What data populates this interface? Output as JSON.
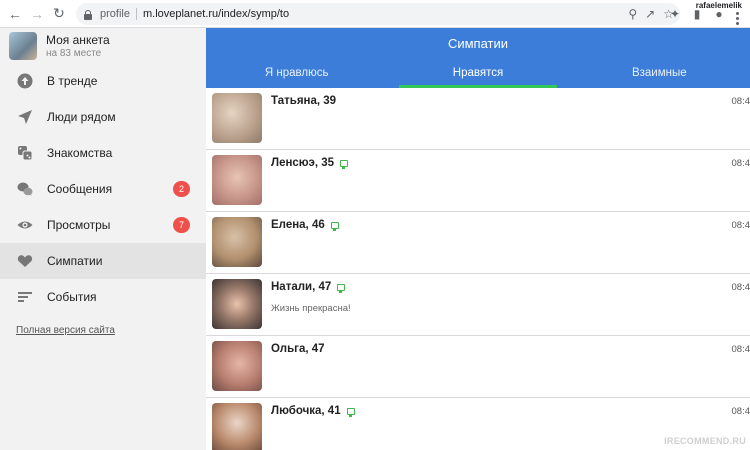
{
  "browser": {
    "address_label": "profile",
    "url": "m.loveplanet.ru/index/symp/to",
    "profile_name": "rafaelemelik"
  },
  "sidebar": {
    "me": {
      "title": "Моя анкета",
      "subtitle": "на 83 месте"
    },
    "items": [
      {
        "label": "В тренде",
        "icon": "trending-up-icon",
        "badge": ""
      },
      {
        "label": "Люди рядом",
        "icon": "location-arrow-icon",
        "badge": ""
      },
      {
        "label": "Знакомства",
        "icon": "dice-icon",
        "badge": ""
      },
      {
        "label": "Сообщения",
        "icon": "chat-bubbles-icon",
        "badge": "2"
      },
      {
        "label": "Просмотры",
        "icon": "eye-icon",
        "badge": "7"
      },
      {
        "label": "Симпатии",
        "icon": "heart-icon",
        "badge": ""
      },
      {
        "label": "События",
        "icon": "lines-icon",
        "badge": ""
      }
    ],
    "full_version": "Полная версия сайта"
  },
  "main": {
    "title": "Симпатии",
    "tabs": [
      {
        "label": "Я нравлюсь"
      },
      {
        "label": "Нравятся"
      },
      {
        "label": "Взаимные"
      }
    ],
    "active_tab": 1,
    "rows": [
      {
        "name": "Татьяна, 39",
        "online": false,
        "status": "",
        "time": "08:4"
      },
      {
        "name": "Ленсюэ, 35",
        "online": true,
        "status": "",
        "time": "08:4"
      },
      {
        "name": "Елена, 46",
        "online": true,
        "status": "",
        "time": "08:4"
      },
      {
        "name": "Натали, 47",
        "online": true,
        "status": "Жизнь прекрасна!",
        "time": "08:4"
      },
      {
        "name": "Ольга, 47",
        "online": false,
        "status": "",
        "time": "08:4"
      },
      {
        "name": "Любочка, 41",
        "online": true,
        "status": "",
        "time": "08:4"
      }
    ]
  },
  "watermark": "IRECOMMEND.RU",
  "colors": {
    "header": "#3b7dd8",
    "tab_indicator": "#35c859",
    "badge": "#f0504c",
    "online": "#3cb94a"
  }
}
